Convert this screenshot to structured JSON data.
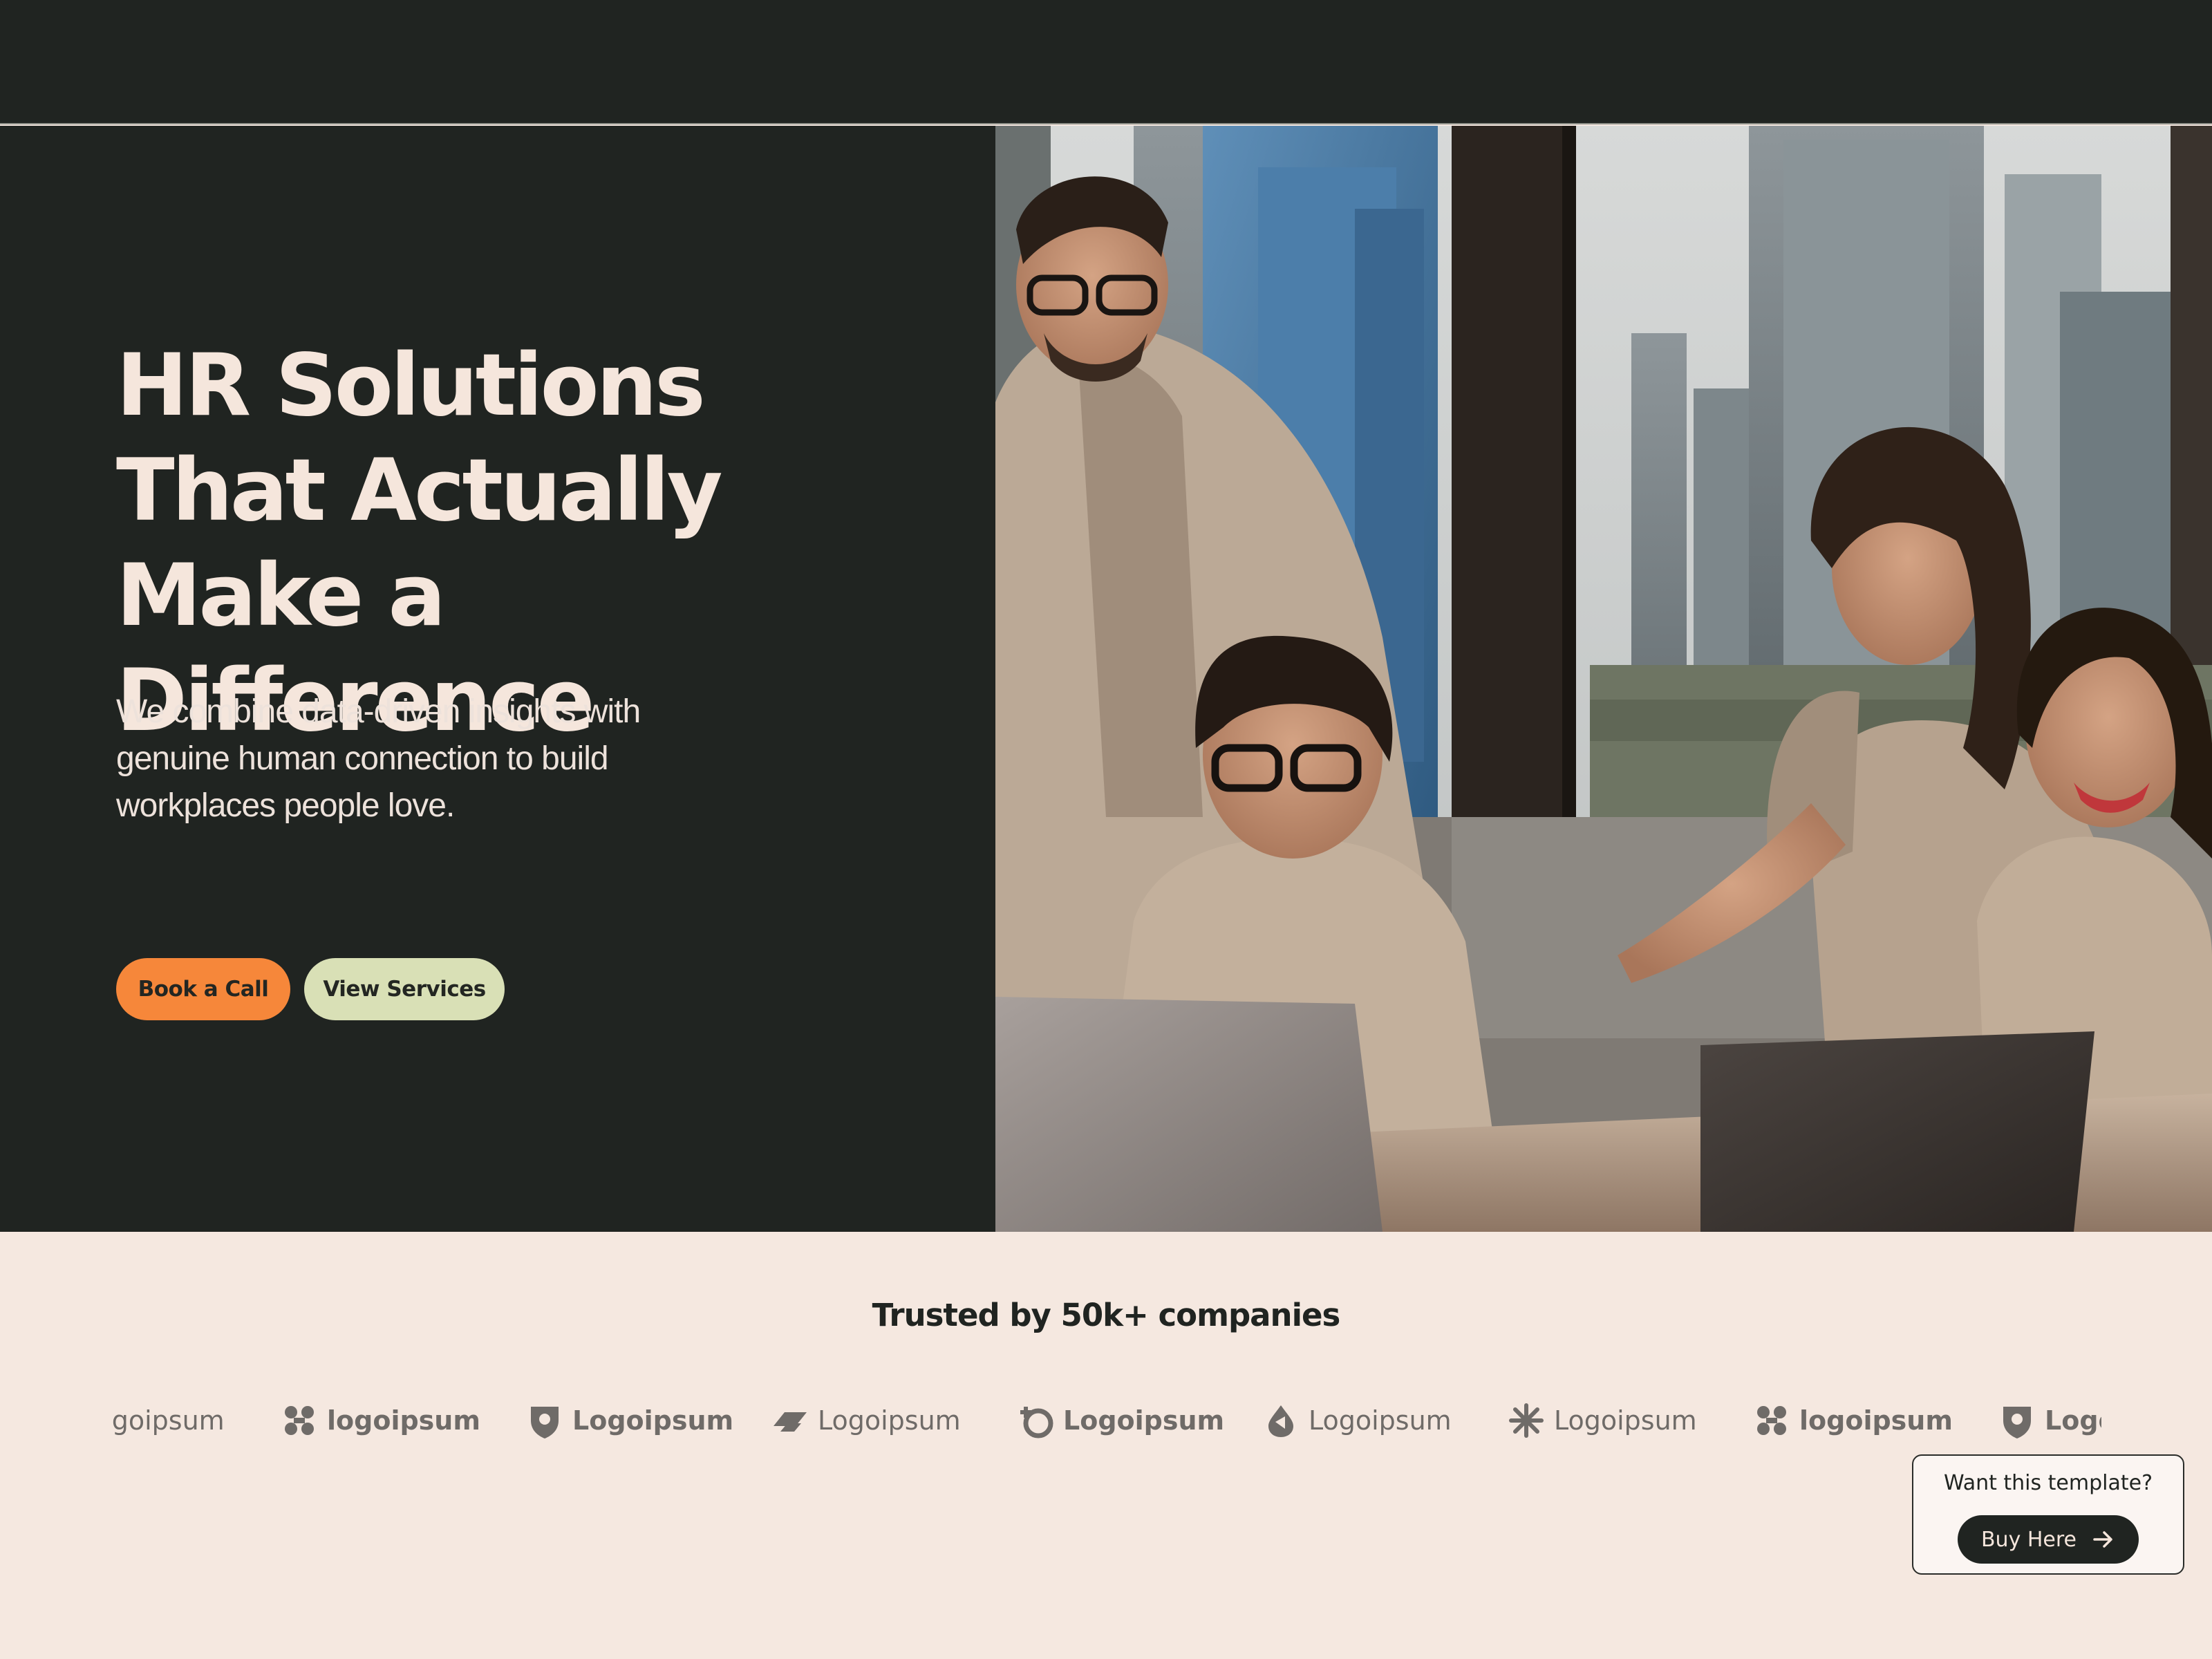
{
  "hero": {
    "headline": "HR Solutions That Actually Make a Difference",
    "subhead": "We combine data-driven insights with genuine human connection to build workplaces people love.",
    "primary_button": "Book a Call",
    "secondary_button": "View Services",
    "photo": "team-office-photo"
  },
  "trusted": {
    "title": "Trusted by 50k+ companies",
    "logos": [
      {
        "icon": "drop-icon",
        "label": "Logoipsum"
      },
      {
        "icon": "swirl-icon",
        "label": "logoipsum"
      },
      {
        "icon": "shield-icon",
        "label": "Logoipsum"
      },
      {
        "icon": "link-icon",
        "label": "Logoipsum"
      },
      {
        "icon": "plus-circle-icon",
        "label": "Logoipsum"
      },
      {
        "icon": "drop-icon",
        "label": "Logoipsum"
      },
      {
        "icon": "star-burst-icon",
        "label": "Logoipsum"
      },
      {
        "icon": "swirl-icon",
        "label": "logoipsum"
      },
      {
        "icon": "shield-icon",
        "label": "Logoipsum"
      }
    ]
  },
  "promo": {
    "title": "Want this template?",
    "button": "Buy Here",
    "button_icon": "arrow-right-icon"
  },
  "colors": {
    "dark": "#202421",
    "cream": "#f5e8e0",
    "accent_orange": "#f6873a",
    "accent_sage": "#d9e0b6"
  }
}
